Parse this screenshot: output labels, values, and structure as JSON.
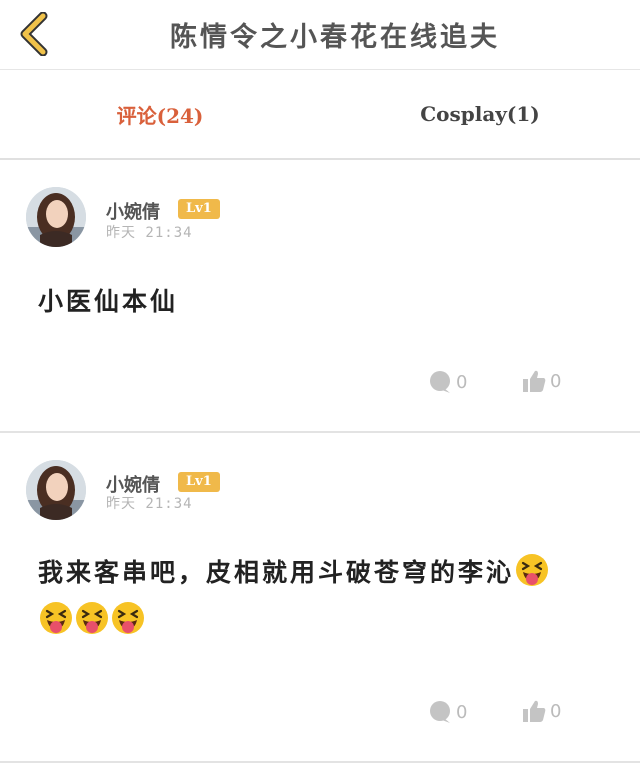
{
  "header": {
    "title": "陈情令之小春花在线追夫"
  },
  "tabs": [
    {
      "label": "评论(24)",
      "active": true
    },
    {
      "label": "Cosplay(1)",
      "active": false
    }
  ],
  "comments": [
    {
      "username": "小婉倩",
      "level": "Lv1",
      "timestamp": "昨天 21:34",
      "text": "小医仙本仙",
      "emoji_count": 0,
      "reply_count": "0",
      "like_count": "0"
    },
    {
      "username": "小婉倩",
      "level": "Lv1",
      "timestamp": "昨天 21:34",
      "text": "我来客串吧，皮相就用斗破苍穹的李沁",
      "emoji_count": 4,
      "emoji_name": "squinting-tongue-emoji",
      "reply_count": "0",
      "like_count": "0"
    }
  ],
  "colors": {
    "accent": "#d9603b",
    "back_arrow": "#f0c24a",
    "badge": "#f0b94a",
    "icon_gray": "#c4c4c4"
  }
}
